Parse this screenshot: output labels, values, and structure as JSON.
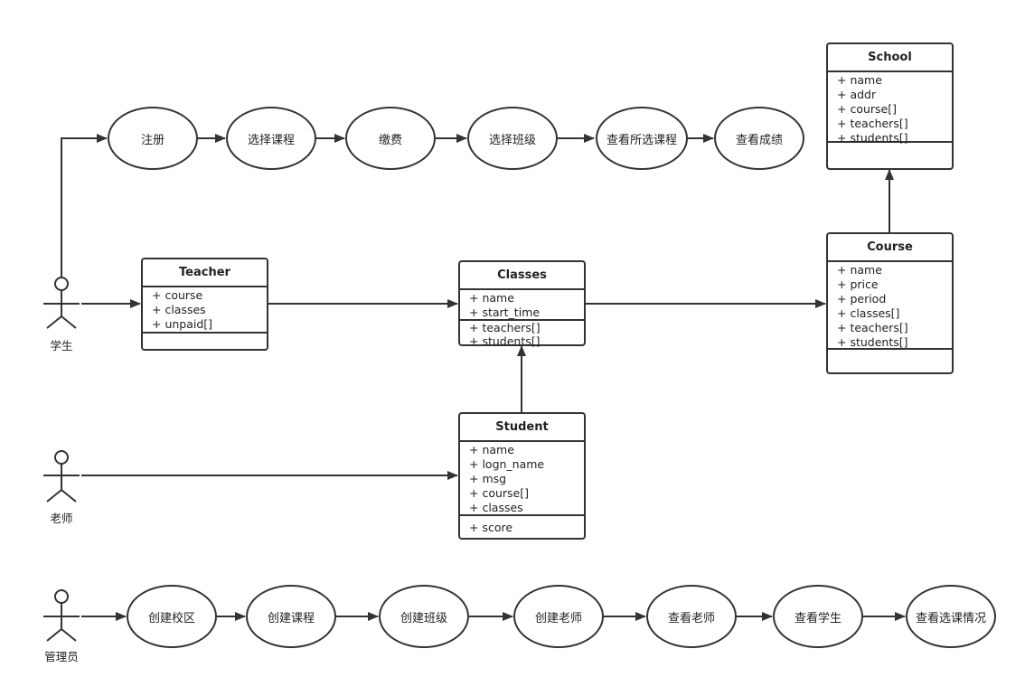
{
  "actors": {
    "student": "学生",
    "teacher": "老师",
    "admin": "管理员"
  },
  "student_flow": [
    "注册",
    "选择课程",
    "缴费",
    "选择班级",
    "查看所选课程",
    "查看成绩"
  ],
  "admin_flow": [
    "创建校区",
    "创建课程",
    "创建班级",
    "创建老师",
    "查看老师",
    "查看学生",
    "查看选课情况"
  ],
  "classes": {
    "school": {
      "name": "School",
      "attrs": [
        "+ name",
        "+ addr",
        "+ course[]",
        "+ teachers[]",
        "+ students[]"
      ]
    },
    "course": {
      "name": "Course",
      "attrs": [
        "+ name",
        "+ price",
        "+ period",
        "+ classes[]",
        "+ teachers[]",
        "+ students[]"
      ]
    },
    "teacher": {
      "name": "Teacher",
      "attrs": [
        "+ course",
        "+ classes",
        "+ unpaid[]"
      ]
    },
    "classes": {
      "name": "Classes",
      "attrs": [
        "+ name",
        "+ start_time"
      ],
      "methods": [
        "+ teachers[]",
        "+ students[]"
      ]
    },
    "student": {
      "name": "Student",
      "attrs": [
        "+ name",
        "+ logn_name",
        "+ msg",
        "+ course[]",
        "+ classes"
      ],
      "methods": [
        "+ score"
      ]
    }
  }
}
